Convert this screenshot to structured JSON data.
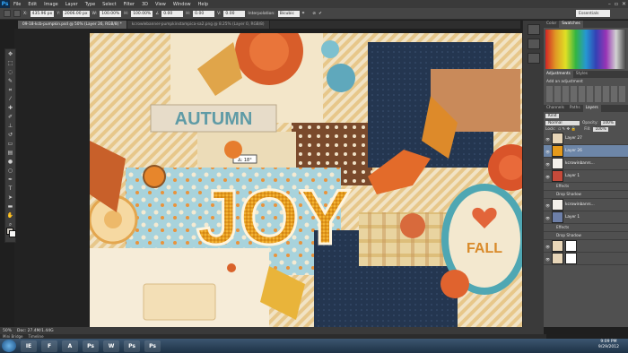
{
  "app": {
    "logo": "Ps"
  },
  "menus": [
    "File",
    "Edit",
    "Image",
    "Layer",
    "Type",
    "Select",
    "Filter",
    "3D",
    "View",
    "Window",
    "Help"
  ],
  "options": {
    "x_value": "435.96 px",
    "y_value": "2006.00 px",
    "w_value": "100.00%",
    "h_value": "100.00%",
    "angle_value": "0.00",
    "hskew_value": "0.00",
    "vskew_value": "0.00",
    "interpolation_label": "Interpolation:",
    "interpolation_value": "Bicubic",
    "workspace": "Essentials"
  },
  "tabs": [
    {
      "label": "09-18-kcb-pumpkin.psd @ 50% (Layer 26, RGB/8) *",
      "active": true
    },
    {
      "label": "kcrowlebanner-pumpkinstampica-sa2.png @ 8.25% (Layer 0, RGB/8)",
      "active": false
    }
  ],
  "canvas": {
    "word_autumn": "AUTUMN",
    "word_joy": "JOY",
    "word_fall": "FALL",
    "tooltip": "∆: 18°"
  },
  "status": {
    "zoom": "50%",
    "doc": "Doc: 27.4M/1.44G"
  },
  "minibridge": [
    "Mini Bridge",
    "Timeline"
  ],
  "panels": {
    "tabs_top": [
      "Color",
      "Swatches"
    ],
    "adjust_tabs": [
      "Adjustments",
      "Styles"
    ],
    "adjust_title": "Add an adjustment",
    "layer_tabs": [
      "Channels",
      "Paths",
      "Layers"
    ],
    "kind": "Kind",
    "blend": "Normal",
    "opacity_label": "Opacity:",
    "opacity_value": "100%",
    "lock_label": "Lock:",
    "fill_label": "Fill:",
    "fill_value": "100%",
    "layers": [
      {
        "name": "Layer 27",
        "selected": false
      },
      {
        "name": "Layer 26",
        "selected": true
      },
      {
        "name": "kcrowinbanrs...",
        "selected": false
      },
      {
        "name": "Layer 1",
        "selected": false,
        "sub": [
          "Effects",
          "Drop Shadow"
        ]
      },
      {
        "name": "kcrowinbanrs...",
        "selected": false
      },
      {
        "name": "Layer 1",
        "selected": false,
        "sub": [
          "Effects",
          "Drop Shadow"
        ]
      },
      {
        "name": "",
        "selected": false
      },
      {
        "name": "",
        "selected": false
      }
    ]
  },
  "taskbar": {
    "apps": [
      "IE",
      "F",
      "A",
      "Ps",
      "W",
      "Ps",
      "Ps"
    ],
    "time": "9:09 PM",
    "date": "9/29/2012"
  },
  "colors": {
    "accent": "#6d86a8",
    "canvas_orange": "#d98a3a",
    "teal": "#4fa7b3"
  }
}
